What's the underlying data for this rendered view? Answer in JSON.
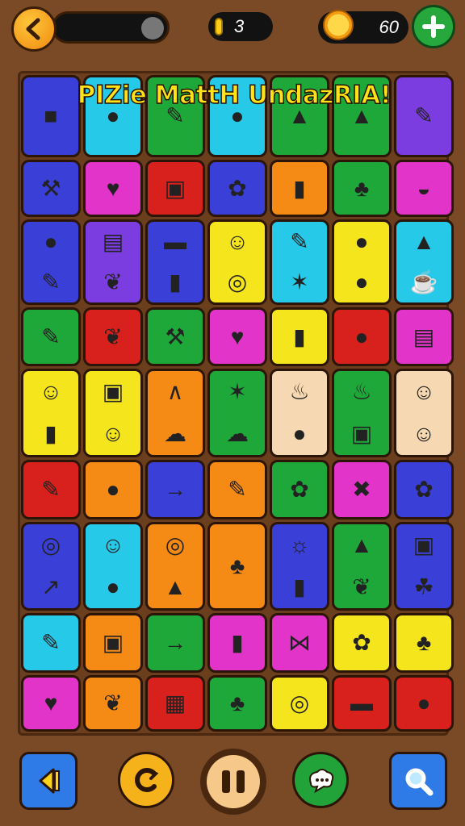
{
  "header": {
    "back_icon": "chevron-left-icon",
    "coins": "3",
    "stars": "60",
    "plus_icon": "plus-icon"
  },
  "title": "PIZie MattH UndazRIA!",
  "colors": {
    "blue": "#3a3fd8",
    "cyan": "#27c9e8",
    "green": "#1fa83a",
    "yellow": "#f4e51c",
    "magenta": "#e234c9",
    "red": "#d8201c",
    "orange": "#f58a14",
    "purple": "#7b3de0",
    "peach": "#f6d9b2",
    "darkblue": "#2254d6"
  },
  "tiles": [
    {
      "c": "blue",
      "i": [
        "flag-icon"
      ]
    },
    {
      "c": "cyan",
      "i": [
        "balloon-icon"
      ]
    },
    {
      "c": "green",
      "i": [
        "brush-icon"
      ]
    },
    {
      "c": "cyan",
      "i": [
        "lemon-icon"
      ]
    },
    {
      "c": "green",
      "i": [
        "carrot-icon"
      ]
    },
    {
      "c": "green",
      "i": [
        "bag-icon"
      ]
    },
    {
      "c": "purple",
      "i": [
        "paintbrush-icon"
      ]
    },
    {
      "c": "blue",
      "i": [
        "trowel-icon"
      ]
    },
    {
      "c": "magenta",
      "i": [
        "heart-icon"
      ]
    },
    {
      "c": "red",
      "i": [
        "box-icon"
      ]
    },
    {
      "c": "blue",
      "i": [
        "flower-icon"
      ]
    },
    {
      "c": "orange",
      "i": [
        "glue-icon"
      ]
    },
    {
      "c": "green",
      "i": [
        "palm-tree-icon"
      ]
    },
    {
      "c": "magenta",
      "i": [
        "bowl-icon"
      ]
    },
    {
      "c": "blue",
      "i": [
        "apple-icon",
        "pencil-icon"
      ]
    },
    {
      "c": "purple",
      "i": [
        "radio-icon",
        "leaf-icon"
      ]
    },
    {
      "c": "blue",
      "i": [
        "bread-icon",
        "tube-icon"
      ]
    },
    {
      "c": "yellow",
      "i": [
        "face-icon",
        "donut-icon"
      ]
    },
    {
      "c": "cyan",
      "i": [
        "marker-icon",
        "chili-icon"
      ]
    },
    {
      "c": "yellow",
      "i": [
        "tomato-icon",
        "melon-icon"
      ]
    },
    {
      "c": "cyan",
      "i": [
        "bell-icon",
        "teacup-icon"
      ]
    },
    {
      "c": "green",
      "i": [
        "marker-icon"
      ]
    },
    {
      "c": "red",
      "i": [
        "leaf-icon"
      ]
    },
    {
      "c": "green",
      "i": [
        "trowel-icon"
      ]
    },
    {
      "c": "magenta",
      "i": [
        "heart-icon"
      ]
    },
    {
      "c": "yellow",
      "i": [
        "glue-icon"
      ]
    },
    {
      "c": "red",
      "i": [
        "balloon-icon"
      ]
    },
    {
      "c": "magenta",
      "i": [
        "notebook-icon"
      ]
    },
    {
      "c": "yellow",
      "i": [
        "face-icon",
        "bottle-icon"
      ]
    },
    {
      "c": "yellow",
      "i": [
        "camera-icon",
        "face-icon"
      ]
    },
    {
      "c": "orange",
      "i": [
        "hanger-icon",
        "cloud-icon"
      ]
    },
    {
      "c": "green",
      "i": [
        "fern-icon",
        "cloud-icon"
      ]
    },
    {
      "c": "peach",
      "i": [
        "fire-icon",
        "ball-icon"
      ]
    },
    {
      "c": "green",
      "i": [
        "fire-icon",
        "box-icon"
      ]
    },
    {
      "c": "peach",
      "i": [
        "face-icon",
        "face-icon"
      ]
    },
    {
      "c": "red",
      "i": [
        "pencil-icon"
      ]
    },
    {
      "c": "orange",
      "i": [
        "tomato-icon"
      ]
    },
    {
      "c": "blue",
      "i": [
        "syringe-icon"
      ]
    },
    {
      "c": "orange",
      "i": [
        "marker-icon"
      ]
    },
    {
      "c": "green",
      "i": [
        "flower-icon"
      ]
    },
    {
      "c": "magenta",
      "i": [
        "scissors-icon"
      ]
    },
    {
      "c": "blue",
      "i": [
        "flower-icon"
      ]
    },
    {
      "c": "blue",
      "i": [
        "plate-icon",
        "arrow-icon"
      ]
    },
    {
      "c": "cyan",
      "i": [
        "face-icon",
        "lemon-icon"
      ]
    },
    {
      "c": "orange",
      "i": [
        "plate-icon",
        "bell-icon"
      ]
    },
    {
      "c": "orange",
      "i": [
        "palm-tree-icon"
      ]
    },
    {
      "c": "blue",
      "i": [
        "sun-face-icon",
        "can-icon"
      ]
    },
    {
      "c": "green",
      "i": [
        "lamp-icon",
        "leaf-icon"
      ]
    },
    {
      "c": "blue",
      "i": [
        "gift-icon",
        "plant-icon"
      ]
    },
    {
      "c": "cyan",
      "i": [
        "marker-icon"
      ]
    },
    {
      "c": "orange",
      "i": [
        "camera-icon"
      ]
    },
    {
      "c": "green",
      "i": [
        "syringe-icon"
      ]
    },
    {
      "c": "magenta",
      "i": [
        "cup-icon"
      ]
    },
    {
      "c": "magenta",
      "i": [
        "bow-icon"
      ]
    },
    {
      "c": "yellow",
      "i": [
        "flower-icon"
      ]
    },
    {
      "c": "yellow",
      "i": [
        "palm-tree-icon"
      ]
    },
    {
      "c": "magenta",
      "i": [
        "heart-icon"
      ]
    },
    {
      "c": "orange",
      "i": [
        "leaf-icon"
      ]
    },
    {
      "c": "red",
      "i": [
        "building-icon"
      ]
    },
    {
      "c": "green",
      "i": [
        "palm-tree-icon"
      ]
    },
    {
      "c": "yellow",
      "i": [
        "plate-icon"
      ]
    },
    {
      "c": "red",
      "i": [
        "book-icon"
      ]
    },
    {
      "c": "red",
      "i": [
        "apple-icon"
      ]
    }
  ],
  "bottom": {
    "left_icon": "back-arrow-icon",
    "refresh_icon": "refresh-icon",
    "pause_icon": "pause-icon",
    "chat_icon": "chat-icon",
    "search_icon": "search-icon"
  }
}
